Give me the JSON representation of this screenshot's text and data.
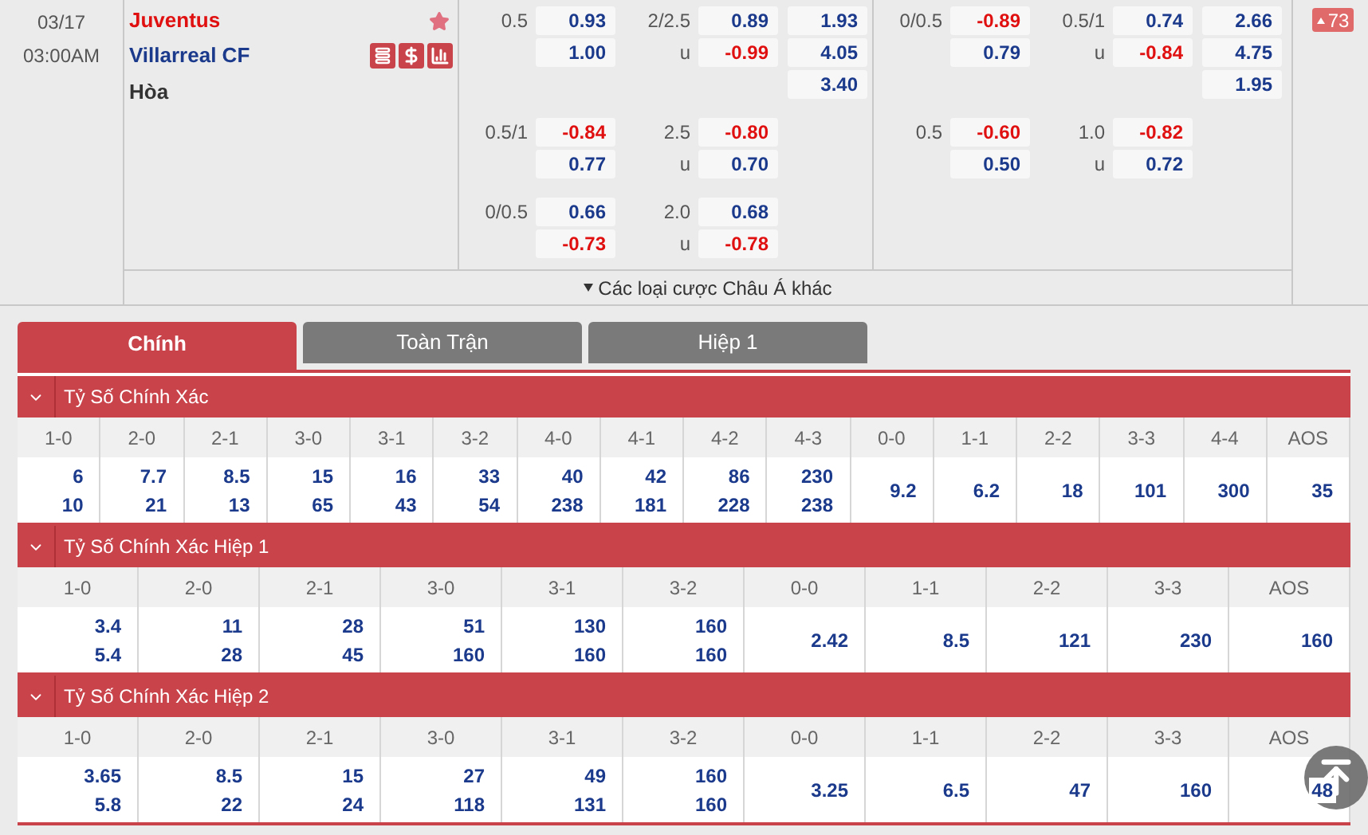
{
  "match": {
    "date": "03/17",
    "time": "03:00AM",
    "home": "Juventus",
    "away": "Villarreal CF",
    "draw": "Hòa"
  },
  "markets": [
    {
      "groups": [
        {
          "handicap": {
            "line": "0.5",
            "home": "0.93",
            "away": "1.00"
          },
          "over_under": {
            "line": "2/2.5",
            "under_label": "u",
            "over": "0.89",
            "under": "-0.99"
          },
          "one_x_two": [
            "1.93",
            "4.05",
            "3.40"
          ]
        },
        {
          "handicap": {
            "line": "0.5/1",
            "home": "-0.84",
            "away": "0.77"
          },
          "over_under": {
            "line": "2.5",
            "under_label": "u",
            "over": "-0.80",
            "under": "0.70"
          }
        },
        {
          "handicap": {
            "line": "0/0.5",
            "home": "0.66",
            "away": "-0.73"
          },
          "over_under": {
            "line": "2.0",
            "under_label": "u",
            "over": "0.68",
            "under": "-0.78"
          }
        }
      ]
    },
    {
      "groups": [
        {
          "handicap": {
            "line": "0/0.5",
            "home": "-0.89",
            "away": "0.79"
          },
          "over_under": {
            "line": "0.5/1",
            "under_label": "u",
            "over": "0.74",
            "under": "-0.84"
          },
          "one_x_two": [
            "2.66",
            "4.75",
            "1.95"
          ]
        },
        {
          "handicap": {
            "line": "0.5",
            "home": "-0.60",
            "away": "0.50"
          },
          "over_under": {
            "line": "1.0",
            "under_label": "u",
            "over": "-0.82",
            "under": "0.72"
          }
        }
      ]
    }
  ],
  "more_link": "Các loại cược Châu Á khác",
  "more_count": "73",
  "tabs": [
    {
      "label": "Chính",
      "selected": true
    },
    {
      "label": "Toàn Trận",
      "selected": false
    },
    {
      "label": "Hiệp 1",
      "selected": false
    }
  ],
  "sections": [
    {
      "title": "Tỷ Số Chính Xác",
      "cells": [
        {
          "label": "1-0",
          "values": [
            "6",
            "10"
          ]
        },
        {
          "label": "2-0",
          "values": [
            "7.7",
            "21"
          ]
        },
        {
          "label": "2-1",
          "values": [
            "8.5",
            "13"
          ]
        },
        {
          "label": "3-0",
          "values": [
            "15",
            "65"
          ]
        },
        {
          "label": "3-1",
          "values": [
            "16",
            "43"
          ]
        },
        {
          "label": "3-2",
          "values": [
            "33",
            "54"
          ]
        },
        {
          "label": "4-0",
          "values": [
            "40",
            "238"
          ]
        },
        {
          "label": "4-1",
          "values": [
            "42",
            "181"
          ]
        },
        {
          "label": "4-2",
          "values": [
            "86",
            "228"
          ]
        },
        {
          "label": "4-3",
          "values": [
            "230",
            "238"
          ]
        },
        {
          "label": "0-0",
          "values": [
            "9.2"
          ]
        },
        {
          "label": "1-1",
          "values": [
            "6.2"
          ]
        },
        {
          "label": "2-2",
          "values": [
            "18"
          ]
        },
        {
          "label": "3-3",
          "values": [
            "101"
          ]
        },
        {
          "label": "4-4",
          "values": [
            "300"
          ]
        },
        {
          "label": "AOS",
          "values": [
            "35"
          ]
        }
      ]
    },
    {
      "title": "Tỷ Số Chính Xác Hiệp 1",
      "cells": [
        {
          "label": "1-0",
          "values": [
            "3.4",
            "5.4"
          ]
        },
        {
          "label": "2-0",
          "values": [
            "11",
            "28"
          ]
        },
        {
          "label": "2-1",
          "values": [
            "28",
            "45"
          ]
        },
        {
          "label": "3-0",
          "values": [
            "51",
            "160"
          ]
        },
        {
          "label": "3-1",
          "values": [
            "130",
            "160"
          ]
        },
        {
          "label": "3-2",
          "values": [
            "160",
            "160"
          ]
        },
        {
          "label": "0-0",
          "values": [
            "2.42"
          ]
        },
        {
          "label": "1-1",
          "values": [
            "8.5"
          ]
        },
        {
          "label": "2-2",
          "values": [
            "121"
          ]
        },
        {
          "label": "3-3",
          "values": [
            "230"
          ]
        },
        {
          "label": "AOS",
          "values": [
            "160"
          ]
        }
      ]
    },
    {
      "title": "Tỷ Số Chính Xác Hiệp 2",
      "cells": [
        {
          "label": "1-0",
          "values": [
            "3.65",
            "5.8"
          ]
        },
        {
          "label": "2-0",
          "values": [
            "8.5",
            "22"
          ]
        },
        {
          "label": "2-1",
          "values": [
            "15",
            "24"
          ]
        },
        {
          "label": "3-0",
          "values": [
            "27",
            "118"
          ]
        },
        {
          "label": "3-1",
          "values": [
            "49",
            "131"
          ]
        },
        {
          "label": "3-2",
          "values": [
            "160",
            "160"
          ]
        },
        {
          "label": "0-0",
          "values": [
            "3.25"
          ]
        },
        {
          "label": "1-1",
          "values": [
            "6.5"
          ]
        },
        {
          "label": "2-2",
          "values": [
            "47"
          ]
        },
        {
          "label": "3-3",
          "values": [
            "160"
          ]
        },
        {
          "label": "AOS",
          "values": [
            "48"
          ]
        }
      ]
    }
  ]
}
